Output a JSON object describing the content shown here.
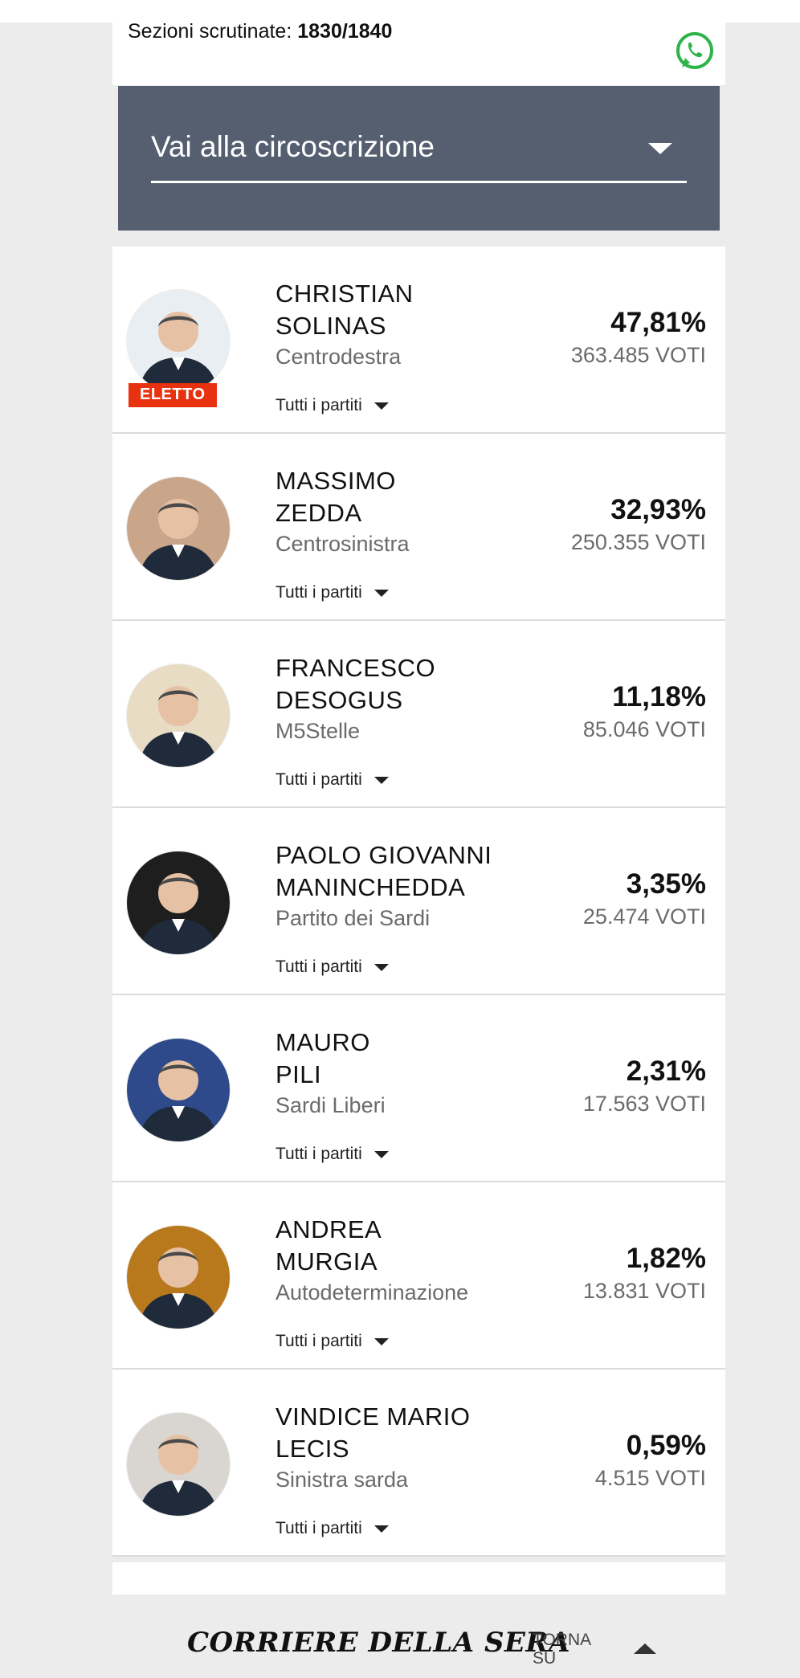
{
  "header": {
    "sections_label": "Sezioni scrutinate:",
    "sections_value": "1830/1840",
    "whatsapp_icon": "whatsapp-icon"
  },
  "selector": {
    "label": "Vai alla circoscrizione",
    "icon": "caret-down-icon"
  },
  "toggle_label": "Tutti i partiti",
  "candidates": [
    {
      "name_line1": "CHRISTIAN",
      "name_line2": "SOLINAS",
      "party": "Centrodestra",
      "percent": "47,81%",
      "votes": "363.485 VOTI",
      "badge": "ELETTO",
      "avatar_bg": "#e9eef2"
    },
    {
      "name_line1": "MASSIMO",
      "name_line2": "ZEDDA",
      "party": "Centrosinistra",
      "percent": "32,93%",
      "votes": "250.355 VOTI",
      "avatar_bg": "#c9a58a"
    },
    {
      "name_line1": "FRANCESCO",
      "name_line2": "DESOGUS",
      "party": "M5Stelle",
      "percent": "11,18%",
      "votes": "85.046 VOTI",
      "avatar_bg": "#e8dcc4"
    },
    {
      "name_line1": "PAOLO GIOVANNI",
      "name_line2": "MANINCHEDDA",
      "party": "Partito dei Sardi",
      "percent": "3,35%",
      "votes": "25.474 VOTI",
      "avatar_bg": "#1e1e1e"
    },
    {
      "name_line1": "MAURO",
      "name_line2": "PILI",
      "party": "Sardi Liberi",
      "percent": "2,31%",
      "votes": "17.563 VOTI",
      "avatar_bg": "#2f4a8a"
    },
    {
      "name_line1": "ANDREA",
      "name_line2": "MURGIA",
      "party": "Autodeterminazione",
      "percent": "1,82%",
      "votes": "13.831 VOTI",
      "avatar_bg": "#b8781c"
    },
    {
      "name_line1": "VINDICE MARIO",
      "name_line2": "LECIS",
      "party": "Sinistra sarda",
      "percent": "0,59%",
      "votes": "4.515 VOTI",
      "avatar_bg": "#d9d6d2"
    }
  ],
  "footer": {
    "logo": "CORRIERE DELLA SERA",
    "back_to_top_line1": "TORNA",
    "back_to_top_line2": "SU",
    "back_to_top_icon": "caret-up-icon"
  }
}
